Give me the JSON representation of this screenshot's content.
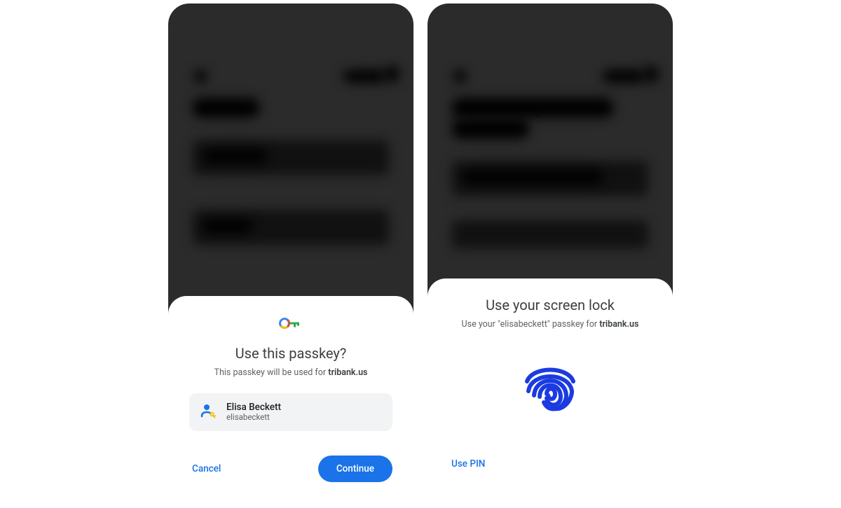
{
  "left": {
    "title": "Use this passkey?",
    "subtitle_prefix": "This passkey will be used for ",
    "subtitle_domain": "tribank.us",
    "account": {
      "name": "Elisa Beckett",
      "username": "elisabeckett"
    },
    "cancel_label": "Cancel",
    "continue_label": "Continue"
  },
  "right": {
    "title": "Use your screen lock",
    "subtitle_prefix": "Use your \"elisabeckett\" passkey for ",
    "subtitle_domain": "tribank.us",
    "pin_label": "Use PIN"
  },
  "colors": {
    "primary_blue": "#1a73e8",
    "fingerprint_blue": "#1b3be1"
  }
}
